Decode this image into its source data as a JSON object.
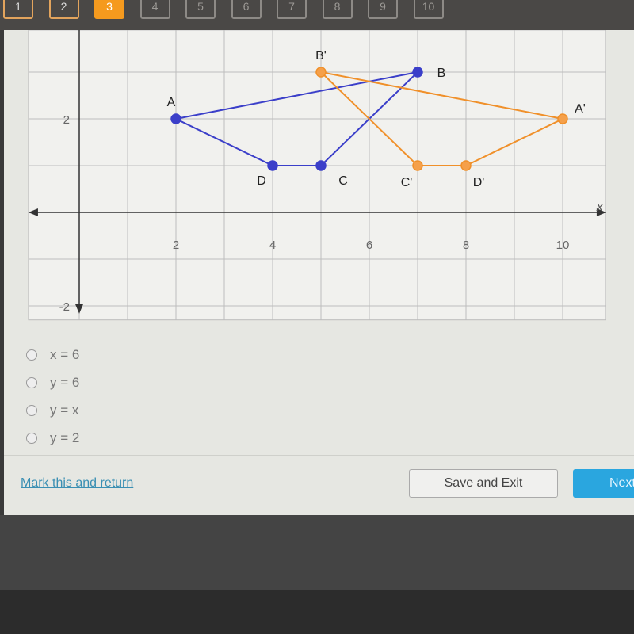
{
  "nav": {
    "questions": [
      "1",
      "2",
      "3",
      "4",
      "5",
      "6",
      "7",
      "8",
      "9",
      "10"
    ],
    "current": 3,
    "answered": [
      1,
      2
    ]
  },
  "graph": {
    "x_ticks": [
      "2",
      "4",
      "6",
      "8",
      "10"
    ],
    "y_ticks": [
      "2",
      "-2"
    ],
    "x_axis_label": "x",
    "colors": {
      "original": "#3b3fc9",
      "image": "#f0902a"
    },
    "original": [
      {
        "label": "A",
        "x": 2,
        "y": 2
      },
      {
        "label": "B",
        "x": 7,
        "y": 3
      },
      {
        "label": "C",
        "x": 5,
        "y": 1
      },
      {
        "label": "D",
        "x": 4,
        "y": 1
      }
    ],
    "image": [
      {
        "label": "A'",
        "x": 10,
        "y": 2
      },
      {
        "label": "B'",
        "x": 5,
        "y": 3
      },
      {
        "label": "C'",
        "x": 7,
        "y": 1
      },
      {
        "label": "D'",
        "x": 8,
        "y": 1
      }
    ]
  },
  "choices": [
    "x = 6",
    "y = 6",
    "y = x",
    "y = 2"
  ],
  "footer": {
    "mark_label": "Mark this and return",
    "save_label": "Save and Exit",
    "next_label": "Next"
  }
}
